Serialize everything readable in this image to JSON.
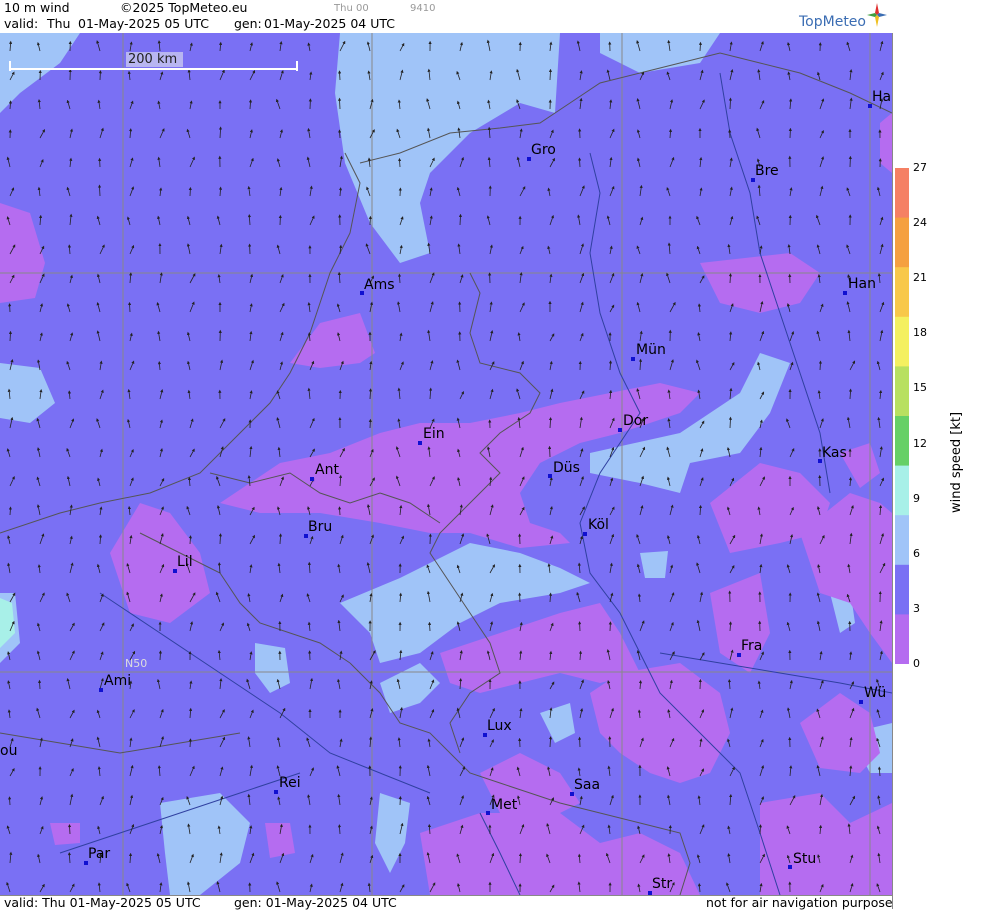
{
  "header": {
    "product": "10 m wind",
    "copyright": "©2025 TopMeteo.eu",
    "valid_label": "valid:",
    "valid_day": "Thu",
    "valid_time": "01-May-2025  05 UTC",
    "gen_label": "gen:",
    "gen_time": "01-May-2025 04 UTC",
    "run_label": "Thu 00",
    "code": "9410",
    "logo": "TopMeteo"
  },
  "footer": {
    "valid": "valid:  Thu  01-May-2025  05 UTC",
    "gen": "gen: 01-May-2025 04 UTC",
    "note": "not for air navigation purposes"
  },
  "scale_bar": {
    "label": "200 km"
  },
  "latitude_label": "N50",
  "legend": {
    "unit": "wind  speed  [kt]",
    "ticks": [
      "27",
      "24",
      "21",
      "18",
      "15",
      "12",
      "9",
      "6",
      "3",
      "0"
    ],
    "colors": [
      "#f58064",
      "#f5a040",
      "#f8c84a",
      "#f4f060",
      "#b8e060",
      "#66d066",
      "#a8f0e8",
      "#a0c4f8",
      "#7a70f4",
      "#b56cf0"
    ]
  },
  "cities": [
    {
      "name": "Gro"
    },
    {
      "name": "Bre"
    },
    {
      "name": "Ha"
    },
    {
      "name": "Ams"
    },
    {
      "name": "Han"
    },
    {
      "name": "Mün"
    },
    {
      "name": "Ein"
    },
    {
      "name": "Dor"
    },
    {
      "name": "Kas"
    },
    {
      "name": "Ant"
    },
    {
      "name": "Düs"
    },
    {
      "name": "Bru"
    },
    {
      "name": "Köl"
    },
    {
      "name": "Lil"
    },
    {
      "name": "Fra"
    },
    {
      "name": "Ami"
    },
    {
      "name": "Wü"
    },
    {
      "name": "Lux"
    },
    {
      "name": "ou"
    },
    {
      "name": "Rei"
    },
    {
      "name": "Saa"
    },
    {
      "name": "Met"
    },
    {
      "name": "Par"
    },
    {
      "name": "Stu"
    },
    {
      "name": "Str"
    }
  ]
}
